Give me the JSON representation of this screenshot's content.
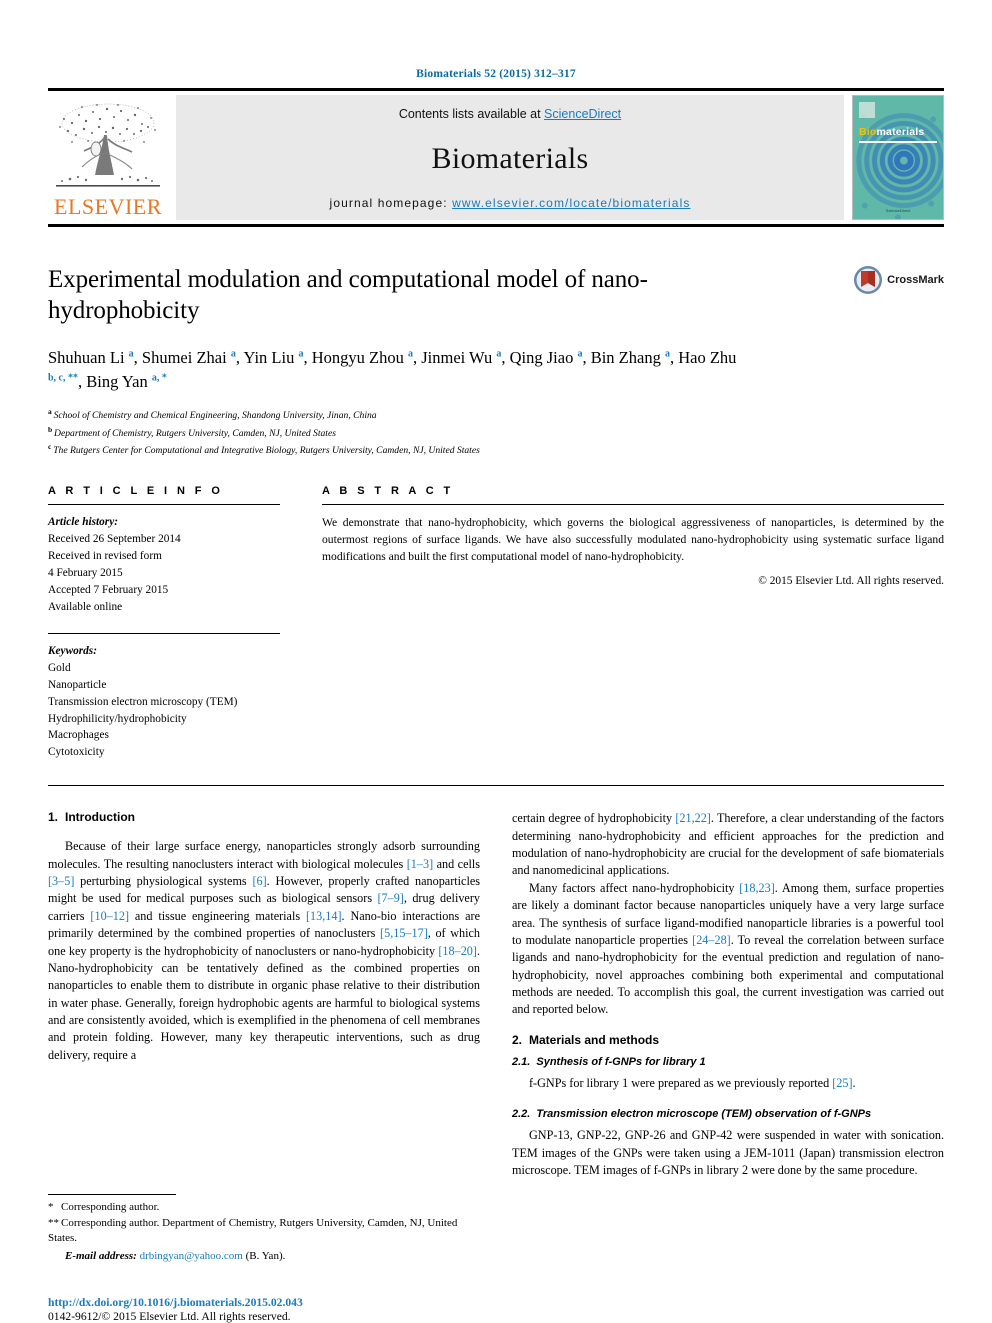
{
  "running_head": "Biomaterials 52 (2015) 312–317",
  "masthead": {
    "contents_prefix": "Contents lists available at ",
    "sciencedirect": "ScienceDirect",
    "journal_name": "Biomaterials",
    "homepage_label": "journal homepage: ",
    "homepage_url": "www.elsevier.com/locate/biomaterials",
    "publisher": "ELSEVIER",
    "cover_title_o": "Bio",
    "cover_title_rest": "materials",
    "cover_footer": "ScienceDirect"
  },
  "article": {
    "title": "Experimental modulation and computational model of nano-hydrophobicity",
    "crossmark_label": "CrossMark",
    "authors": [
      {
        "name": "Shuhuan Li",
        "sup": "a",
        "sep": ", "
      },
      {
        "name": "Shumei Zhai",
        "sup": "a",
        "sep": ", "
      },
      {
        "name": "Yin Liu",
        "sup": "a",
        "sep": ", "
      },
      {
        "name": "Hongyu Zhou",
        "sup": "a",
        "sep": ", "
      },
      {
        "name": "Jinmei Wu",
        "sup": "a",
        "sep": ", "
      },
      {
        "name": "Qing Jiao",
        "sup": "a",
        "sep": ", "
      },
      {
        "name": "Bin Zhang",
        "sup": "a",
        "sep": ", "
      },
      {
        "name": "Hao Zhu",
        "sup": "b, c, **",
        "sep": ", "
      },
      {
        "name": "Bing Yan",
        "sup": "a, *",
        "sep": ""
      }
    ],
    "affiliations": [
      {
        "mark": "a",
        "text": "School of Chemistry and Chemical Engineering, Shandong University, Jinan, China"
      },
      {
        "mark": "b",
        "text": "Department of Chemistry, Rutgers University, Camden, NJ, United States"
      },
      {
        "mark": "c",
        "text": "The Rutgers Center for Computational and Integrative Biology, Rutgers University, Camden, NJ, United States"
      }
    ]
  },
  "article_info": {
    "heading": "A R T I C L E  I N F O",
    "history_label": "Article history:",
    "history": [
      "Received 26 September 2014",
      "Received in revised form",
      "4 February 2015",
      "Accepted 7 February 2015",
      "Available online"
    ],
    "keywords_label": "Keywords:",
    "keywords": [
      "Gold",
      "Nanoparticle",
      "Transmission electron microscopy (TEM)",
      "Hydrophilicity/hydrophobicity",
      "Macrophages",
      "Cytotoxicity"
    ]
  },
  "abstract": {
    "heading": "A B S T R A C T",
    "text": "We demonstrate that nano-hydrophobicity, which governs the biological aggressiveness of nanoparticles, is determined by the outermost regions of surface ligands. We have also successfully modulated nano-hydrophobicity using systematic surface ligand modifications and built the first computational model of nano-hydrophobicity.",
    "copyright": "© 2015 Elsevier Ltd. All rights reserved."
  },
  "sections": {
    "intro_number": "1.",
    "intro_title": "Introduction",
    "intro_p1_a": "Because of their large surface energy, nanoparticles strongly adsorb surrounding molecules. The resulting nanoclusters interact with biological molecules ",
    "cite_1_3": "[1–3]",
    "intro_p1_b": " and cells ",
    "cite_3_5": "[3–5]",
    "intro_p1_c": " perturbing physiological systems ",
    "cite_6": "[6]",
    "intro_p1_d": ". However, properly crafted nanoparticles might be used for medical purposes such as biological sensors ",
    "cite_7_9": "[7–9]",
    "intro_p1_e": ", drug delivery carriers ",
    "cite_10_12": "[10–12]",
    "intro_p1_f": " and tissue engineering materials ",
    "cite_13_14": "[13,14]",
    "intro_p1_g": ". Nano-bio interactions are primarily determined by the combined properties of nanoclusters ",
    "cite_5_15_17": "[5,15–17]",
    "intro_p1_h": ", of which one key property is the hydrophobicity of nanoclusters or nano-hydrophobicity ",
    "cite_18_20": "[18–20]",
    "intro_p1_i": ". Nano-hydrophobicity can be tentatively defined as the combined properties on nanoparticles to enable them to distribute in organic phase relative to their distribution in water phase. Generally, foreign hydrophobic agents are harmful to biological systems and are consistently avoided, which is exemplified in the phenomena of cell membranes and protein folding. However, many key therapeutic interventions, such as drug delivery, require a ",
    "intro_p2_a": "certain degree of hydrophobicity ",
    "cite_21_22": "[21,22]",
    "intro_p2_b": ". Therefore, a clear understanding of the factors determining nano-hydrophobicity and efficient approaches for the prediction and modulation of nano-hydrophobicity are crucial for the development of safe biomaterials and nanomedicinal applications.",
    "intro_p3_a": "Many factors affect nano-hydrophobicity ",
    "cite_18_23": "[18,23]",
    "intro_p3_b": ". Among them, surface properties are likely a dominant factor because nanoparticles uniquely have a very large surface area. The synthesis of surface ligand-modified nanoparticle libraries is a powerful tool to modulate nanoparticle properties ",
    "cite_24_28": "[24–28]",
    "intro_p3_c": ". To reveal the correlation between surface ligands and nano-hydrophobicity for the eventual prediction and regulation of nano-hydrophobicity, novel approaches combining both experimental and computational methods are needed. To accomplish this goal, the current investigation was carried out and reported below.",
    "methods_number": "2.",
    "methods_title": "Materials and methods",
    "sub21_number": "2.1.",
    "sub21_title": "Synthesis of f-GNPs for library 1",
    "sub21_a": "f-GNPs for library 1 were prepared as we previously reported ",
    "cite_25": "[25]",
    "sub21_b": ".",
    "sub22_number": "2.2.",
    "sub22_title": "Transmission electron microscope (TEM) observation of f-GNPs",
    "sub22_text": "GNP-13, GNP-22, GNP-26 and GNP-42 were suspended in water with sonication. TEM images of the GNPs were taken using a JEM-1011 (Japan) transmission electron microscope. TEM images of f-GNPs in library 2 were done by the same procedure."
  },
  "footnotes": {
    "fn1_mark": "*",
    "fn1_text": "Corresponding author.",
    "fn2_mark": "**",
    "fn2_text": "Corresponding author. Department of Chemistry, Rutgers University, Camden, NJ, United States.",
    "email_label": "E-mail address:",
    "email": "drbingyan@yahoo.com",
    "email_owner": "(B. Yan).",
    "doi": "http://dx.doi.org/10.1016/j.biomaterials.2015.02.043",
    "issn": "0142-9612/© 2015 Elsevier Ltd. All rights reserved."
  },
  "colors": {
    "link": "#1a7bbd",
    "elsevier_orange": "#e87722",
    "cover_bg": "#5fb8a8"
  }
}
